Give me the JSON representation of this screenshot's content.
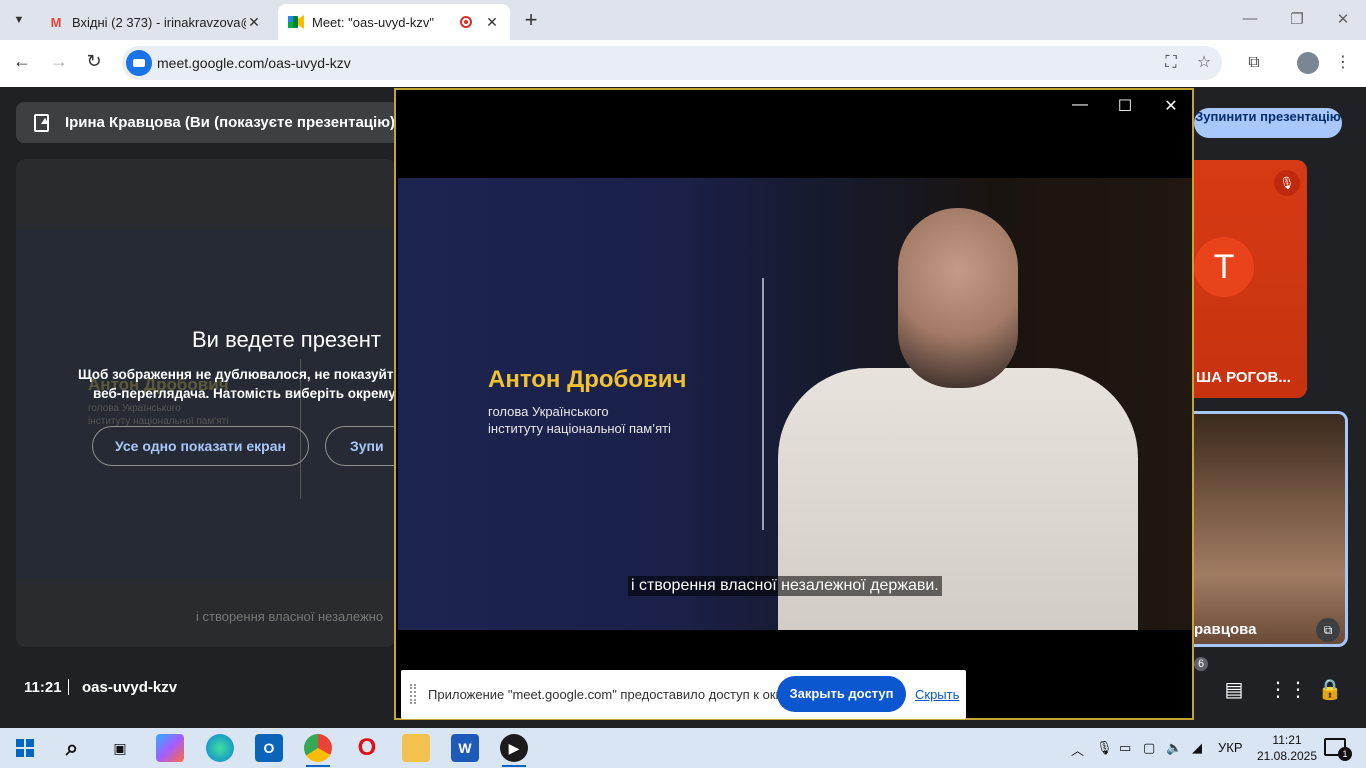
{
  "browser": {
    "tabs": [
      {
        "title": "Вхідні (2 373) - irinakravzova@",
        "favicon": "gmail-icon"
      },
      {
        "title": "Meet: \"oas-uvyd-kzv\"",
        "favicon": "meet-icon",
        "recording": true
      }
    ],
    "url": "meet.google.com/oas-uvyd-kzv"
  },
  "meet": {
    "presenter_banner": "Ірина Кравцова (Ви (показуєте презентацію))",
    "stop_button": "Зупинити презентацію",
    "presenting_title": "Ви ведете презент",
    "presenting_desc_1": "Щоб зображення не дублювалося, не показуйт",
    "presenting_desc_2": "веб-переглядача. Натомість виберіть окрему",
    "show_anyway_button": "Усе одно показати екран",
    "stop_partial_button": "Зупи",
    "ghost_name": "Антон Дробович",
    "ghost_role_1": "голова Українського",
    "ghost_role_2": "інституту національної пам'яті",
    "ghost_caption": "і створення власної незалежно",
    "time": "11:21",
    "code": "oas-uvyd-kzv",
    "participant_t": {
      "initial": "Т",
      "name": "ША РОГОВ..."
    },
    "participant_v": {
      "name": "равцова"
    },
    "participant_count": "6"
  },
  "video": {
    "speaker_name": "Антон Дробович",
    "speaker_role_1": "голова Українського",
    "speaker_role_2": "інституту національної пам’яті",
    "subtitle": "і створення власної незалежної держави."
  },
  "share_bar": {
    "message": "Приложение \"meet.google.com\" предоставило доступ к окну.",
    "close_button": "Закрыть доступ",
    "hide_link": "Скрыть"
  },
  "taskbar": {
    "language": "УКР",
    "time": "11:21",
    "date": "21.08.2025",
    "notifications": "1"
  },
  "colors": {
    "accent": "#1a73e8",
    "share_button": "#0b57d0",
    "speaker_name": "#f2c230",
    "pip_border": "#c5a432",
    "tile_orange": "#d63a14"
  }
}
